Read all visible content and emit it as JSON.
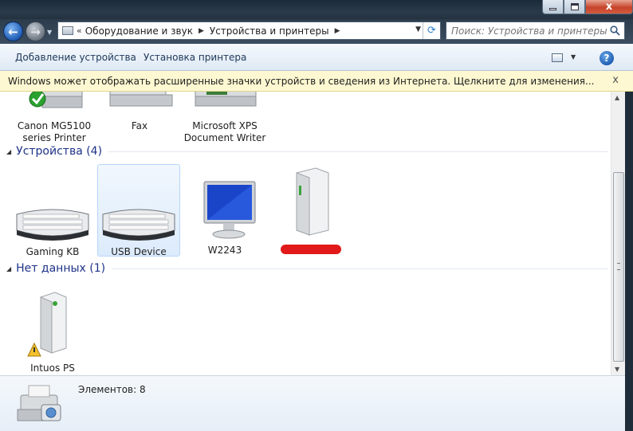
{
  "window": {
    "min_label": "",
    "max_label": "",
    "close_label": "x"
  },
  "address_bar": {
    "chevron": "«",
    "crumbs": [
      "Оборудование и звук",
      "Устройства и принтеры"
    ],
    "search_placeholder": "Поиск: Устройства и принтеры"
  },
  "command_bar": {
    "add_device": "Добавление устройства",
    "add_printer": "Установка принтера",
    "help": "?"
  },
  "info_bar": {
    "text": "Windows может отображать расширенные значки устройств и сведения из Интернета.  Щелкните для изменения...",
    "close": "x"
  },
  "printers": [
    {
      "label": "Canon MG5100\nseries Printer",
      "icon": "printer-icon",
      "status": "default-checkmark"
    },
    {
      "label": "Fax",
      "icon": "fax-icon"
    },
    {
      "label": "Microsoft XPS\nDocument Writer",
      "icon": "printer-icon"
    }
  ],
  "groups": {
    "devices": {
      "title": "Устройства (4)"
    },
    "unspecified": {
      "title": "Нет данных (1)"
    }
  },
  "devices": [
    {
      "label": "Gaming KB",
      "icon": "keyboard-icon"
    },
    {
      "label": "USB Device",
      "icon": "keyboard-icon",
      "selected": true
    },
    {
      "label": "W2243",
      "icon": "monitor-icon"
    },
    {
      "label": "",
      "icon": "computer-tower-icon",
      "note": "label redacted"
    }
  ],
  "unspecified": [
    {
      "label": "Intuos PS",
      "icon": "computer-tower-icon",
      "status": "warning"
    }
  ],
  "details": {
    "count_text": "Элементов: 8"
  },
  "colors": {
    "group_header": "#1e3287",
    "info_bar_bg": "#fdf8d1",
    "selection": "#dcebfc"
  }
}
